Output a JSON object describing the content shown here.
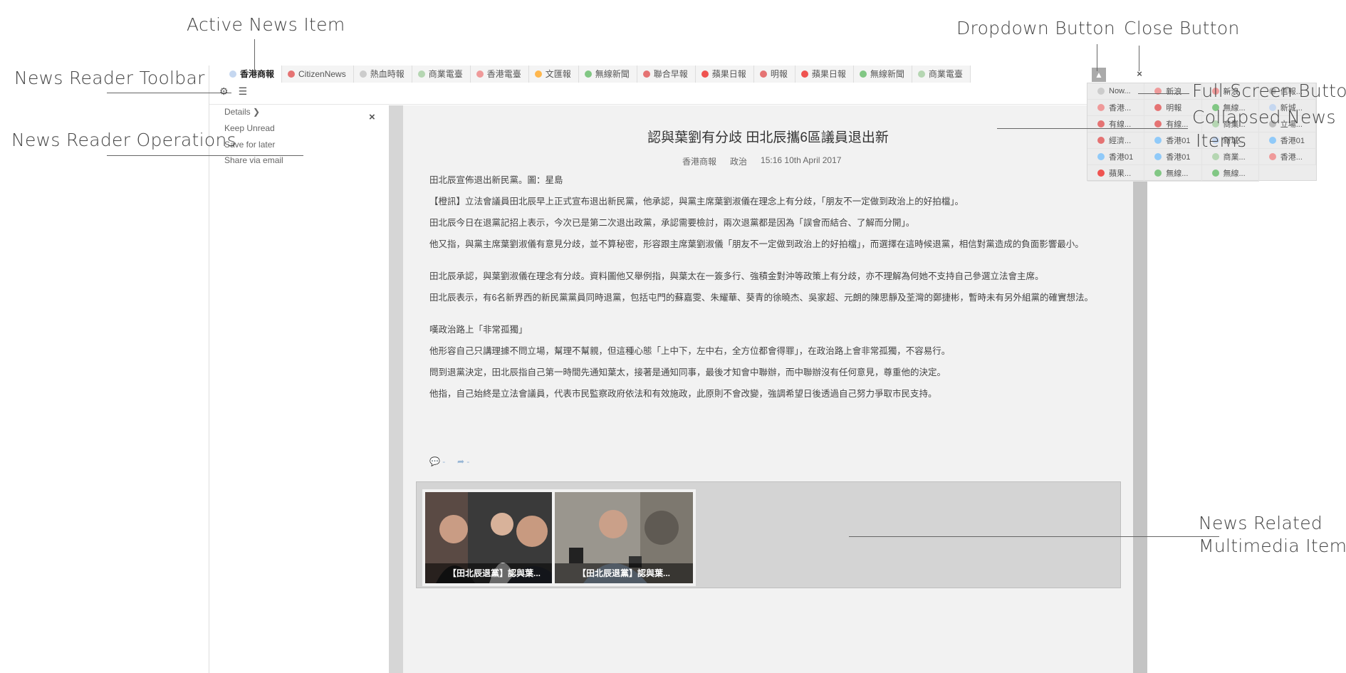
{
  "tabs": [
    {
      "label": "香港商報",
      "color": "#c5d7f0",
      "active": true
    },
    {
      "label": "CitizenNews",
      "color": "#e57373"
    },
    {
      "label": "熱血時報",
      "color": "#cccccc"
    },
    {
      "label": "商業電臺",
      "color": "#b5d6b2"
    },
    {
      "label": "香港電臺",
      "color": "#ef9a9a"
    },
    {
      "label": "文匯報",
      "color": "#ffb74d"
    },
    {
      "label": "無線新聞",
      "color": "#81c784"
    },
    {
      "label": "聯合早報",
      "color": "#e57373"
    },
    {
      "label": "蘋果日報",
      "color": "#ef5350"
    },
    {
      "label": "明報",
      "color": "#e57373"
    },
    {
      "label": "蘋果日報",
      "color": "#ef5350"
    },
    {
      "label": "無線新聞",
      "color": "#81c784"
    },
    {
      "label": "商業電臺",
      "color": "#b5d6b2"
    }
  ],
  "buttons": {
    "dropdown": "▲",
    "close": "×",
    "fullscreen": "⤧"
  },
  "toolbar": {
    "settings_icon": "gear-icon",
    "menu_icon": "menu-icon",
    "settings_glyph": "⚙",
    "menu_glyph": "☰"
  },
  "operations": {
    "close_glyph": "×",
    "items": [
      "Details ❯",
      "Keep Unread",
      "Save for later",
      "Share via email"
    ]
  },
  "article": {
    "title": "認與葉劉有分歧 田北辰攜6區議員退出新",
    "source": "香港商報",
    "category": "政治",
    "time": "15:16 10th April 2017",
    "paragraphs": [
      "田北辰宣佈退出新民黨。圖：星島",
      "【橙訊】立法會議員田北辰早上正式宣布退出新民黨，他承認，與黨主席葉劉淑儀在理念上有分歧，「朋友不一定做到政治上的好拍檔」。",
      "田北辰今日在退黨記招上表示，今次已是第二次退出政黨，承認需要檢討，兩次退黨都是因為「誤會而結合、了解而分開」。",
      "他又指，與黨主席葉劉淑儀有意見分歧，並不算秘密，形容跟主席葉劉淑儀「朋友不一定做到政治上的好拍檔」，而選擇在這時候退黨，相信對黨造成的負面影響最小。",
      "田北辰承認，與葉劉淑儀在理念有分歧。資料圖他又舉例指，與葉太在一簽多行、強積金對沖等政策上有分歧，亦不理解為何她不支持自己參選立法會主席。",
      "田北辰表示，有6名新界西的新民黨黨員同時退黨，包括屯門的蘇嘉雯、朱耀華、葵青的徐曉杰、吳家超、元朗的陳思靜及荃灣的鄭捷彬，暫時未有另外組黨的確實想法。",
      "嘆政治路上「非常孤獨」",
      "他形容自己只講理據不問立場，幫理不幫親，但這種心態「上中下，左中右，全方位都會得罪」，在政治路上會非常孤獨，不容易行。",
      "問到退黨決定，田北辰指自己第一時間先通知葉太，接著是通知同事，最後才知會中聯辦，而中聯辦沒有任何意見，尊重他的決定。",
      "他指，自己始終是立法會議員，代表市民監察政府依法和有效施政，此原則不會改變，強調希望日後透過自己努力爭取市民支持。"
    ],
    "social": {
      "comments": "-",
      "shares": "-",
      "comment_glyph": "💬",
      "share_glyph": "➦"
    }
  },
  "media": [
    {
      "caption": "【田北辰退黨】認與葉..."
    },
    {
      "caption": "【田北辰退黨】認與葉..."
    }
  ],
  "dropdown_items": [
    {
      "label": "Now...",
      "color": "#cccccc"
    },
    {
      "label": "新浪",
      "color": "#ef9a9a"
    },
    {
      "label": "新浪",
      "color": "#ef9a9a"
    },
    {
      "label": "信報...",
      "color": "#bbbbbb"
    },
    {
      "label": "香港...",
      "color": "#ef9a9a"
    },
    {
      "label": "明報",
      "color": "#e57373"
    },
    {
      "label": "無線...",
      "color": "#81c784"
    },
    {
      "label": "新城...",
      "color": "#c5d7f0"
    },
    {
      "label": "有線...",
      "color": "#e57373"
    },
    {
      "label": "有線...",
      "color": "#e57373"
    },
    {
      "label": "商業...",
      "color": "#b5d6b2"
    },
    {
      "label": "立場...",
      "color": "#bbbbbb"
    },
    {
      "label": "經濟...",
      "color": "#e57373"
    },
    {
      "label": "香港01",
      "color": "#90caf9"
    },
    {
      "label": "新城...",
      "color": "#c5d7f0"
    },
    {
      "label": "香港01",
      "color": "#90caf9"
    },
    {
      "label": "香港01",
      "color": "#90caf9"
    },
    {
      "label": "香港01",
      "color": "#90caf9"
    },
    {
      "label": "商業...",
      "color": "#b5d6b2"
    },
    {
      "label": "香港...",
      "color": "#ef9a9a"
    },
    {
      "label": "蘋果...",
      "color": "#ef5350"
    },
    {
      "label": "無線...",
      "color": "#81c784"
    },
    {
      "label": "無線...",
      "color": "#81c784"
    }
  ],
  "callouts": {
    "active_news_item": "Active News Item",
    "news_reader_toolbar": "News Reader Toolbar",
    "news_reader_operations": "News Reader Operations",
    "dropdown_button": "Dropdown Button",
    "close_button": "Close Button",
    "fullscreen_button": "Full-Screen Button",
    "collapsed_line1": "Collapsed News",
    "collapsed_line2": "Items",
    "multimedia_line1": "News Related",
    "multimedia_line2": "Multimedia Items"
  }
}
